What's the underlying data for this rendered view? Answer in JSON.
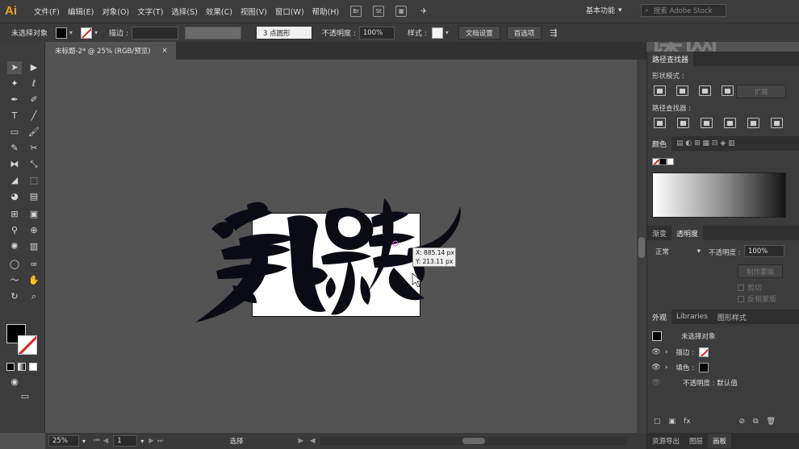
{
  "app": {
    "logo": "Ai"
  },
  "menu": {
    "items": [
      "文件(F)",
      "编辑(E)",
      "对象(O)",
      "文字(T)",
      "选择(S)",
      "效果(C)",
      "视图(V)",
      "窗口(W)",
      "帮助(H)"
    ]
  },
  "menu_icons": [
    "Br",
    "St"
  ],
  "workspace": {
    "label": "基本功能"
  },
  "search": {
    "placeholder": "搜索 Adobe Stock"
  },
  "watermark": {
    "text": "虎课网"
  },
  "control": {
    "selection_label": "未选择对象",
    "stroke_label": "描边 :",
    "stroke_value": "",
    "brush_label": "3 点圆形",
    "opacity_label": "不透明度 :",
    "opacity_value": "100%",
    "style_label": "样式 :",
    "doc_settings": "文档设置",
    "preferences": "首选项"
  },
  "document": {
    "tab_label": "未标题-2* @ 25% (RGB/预览)",
    "close": "×"
  },
  "tooltip": {
    "x": "X: 885.14 px",
    "y": "Y: 213.11 px"
  },
  "statusbar": {
    "zoom": "25%",
    "page": "1",
    "mode": "选择"
  },
  "pathfinder": {
    "tab": "路径查找器",
    "shape_modes_label": "形状模式 :",
    "expand_label": "扩展",
    "pathfinders_label": "路径查找器 :"
  },
  "color": {
    "tabs": [
      "颜色"
    ],
    "accent": "#ffffff"
  },
  "transparency": {
    "tabs": [
      "渐变",
      "透明度"
    ],
    "blend_mode": "正常",
    "opacity_label": "不透明度 :",
    "opacity_value": "100%",
    "make_mask": "制作蒙版",
    "clip_label": "剪切",
    "invert_label": "反相蒙版"
  },
  "appearance": {
    "tabs": [
      "外观",
      "Libraries",
      "图形样式"
    ],
    "title": "未选择对象",
    "stroke": "描边 :",
    "fill": "填色 :",
    "opacity": "不透明度 : 默认值"
  },
  "bottom_tabs": [
    "资源导出",
    "图层",
    "画板"
  ],
  "colors": {
    "brand": "#f7a21b",
    "ink": "#0b0b16",
    "panel": "#3c3c3c",
    "canvas": "#535353"
  }
}
